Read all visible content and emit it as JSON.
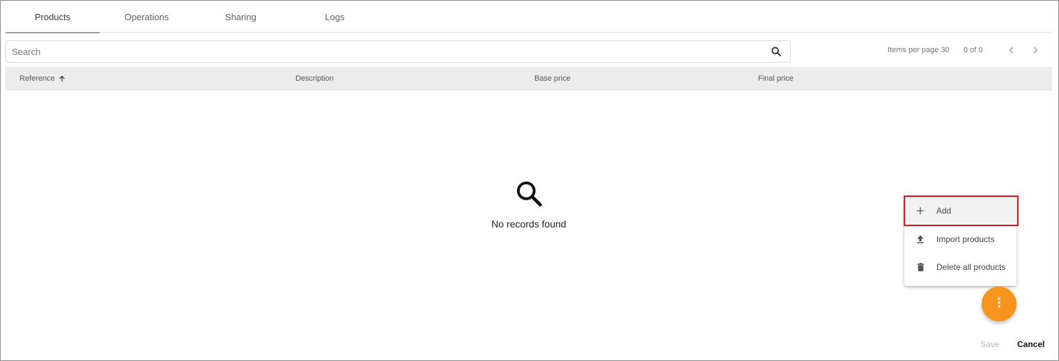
{
  "tabs": [
    {
      "label": "Products",
      "active": true
    },
    {
      "label": "Operations",
      "active": false
    },
    {
      "label": "Sharing",
      "active": false
    },
    {
      "label": "Logs",
      "active": false
    }
  ],
  "search": {
    "placeholder": "Search",
    "value": "",
    "icon": "search-icon"
  },
  "pagination": {
    "items_per_page_label": "Items per page",
    "items_per_page": "30",
    "range": "0 of 0"
  },
  "table": {
    "columns": [
      {
        "label": "Reference",
        "sort": "ascending"
      },
      {
        "label": "Description"
      },
      {
        "label": "Base price"
      },
      {
        "label": "Final price"
      }
    ],
    "rows": []
  },
  "empty_state": {
    "message": "No records found",
    "icon": "search-icon"
  },
  "speed_dial": {
    "items": [
      {
        "label": "Add",
        "icon": "plus-icon",
        "highlighted": true
      },
      {
        "label": "Import products",
        "icon": "upload-icon"
      },
      {
        "label": "Delete all products",
        "icon": "trash-icon"
      }
    ],
    "fab_icon": "more-vertical-icon",
    "fab_color": "#f7941d"
  },
  "footer": {
    "save_label": "Save",
    "cancel_label": "Cancel"
  },
  "colors": {
    "accent": "#f7941d",
    "highlight": "#e0141e"
  }
}
